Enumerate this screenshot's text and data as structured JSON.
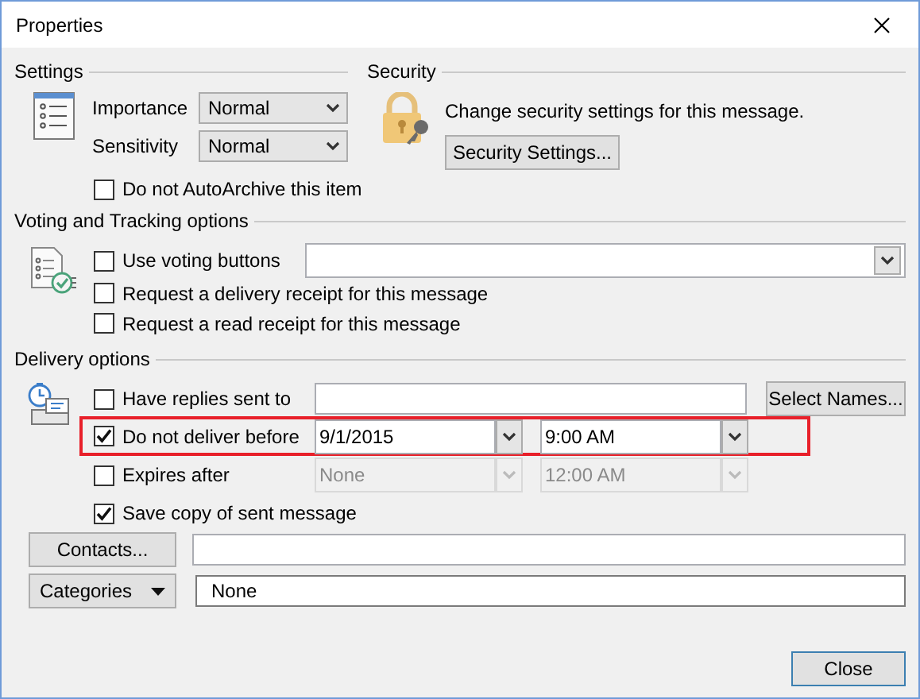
{
  "window": {
    "title": "Properties"
  },
  "settings": {
    "title": "Settings",
    "fields": [
      {
        "label": "Importance",
        "value": "Normal"
      },
      {
        "label": "Sensitivity",
        "value": "Normal"
      }
    ],
    "auto_archive": {
      "label": "Do not AutoArchive this item",
      "checked": false
    }
  },
  "security": {
    "title": "Security",
    "description": "Change security settings for this message.",
    "button": "Security Settings..."
  },
  "voting": {
    "title": "Voting and Tracking options",
    "options": [
      {
        "kind": "combo",
        "label": "Use voting buttons",
        "checked": false
      },
      {
        "kind": "plain",
        "label": "Request a delivery receipt for this message",
        "checked": false
      },
      {
        "kind": "plain",
        "label": "Request a read receipt for this message",
        "checked": false
      }
    ]
  },
  "delivery": {
    "title": "Delivery options",
    "rows": [
      {
        "kind": "text",
        "label": "Have replies sent to",
        "checked": false,
        "button": "Select Names..."
      },
      {
        "kind": "datetime",
        "label": "Do not deliver before",
        "checked": true,
        "highlighted": true,
        "disabled": false,
        "date": "9/1/2015",
        "time": "9:00 AM"
      },
      {
        "kind": "datetime",
        "label": "Expires after",
        "checked": false,
        "highlighted": false,
        "disabled": true,
        "date": "None",
        "time": "12:00 AM"
      },
      {
        "kind": "plain",
        "label": "Save copy of sent message",
        "checked": true
      }
    ]
  },
  "contacts": {
    "button": "Contacts..."
  },
  "categories": {
    "button": "Categories",
    "value": "None"
  },
  "footer": {
    "button": "Close"
  }
}
